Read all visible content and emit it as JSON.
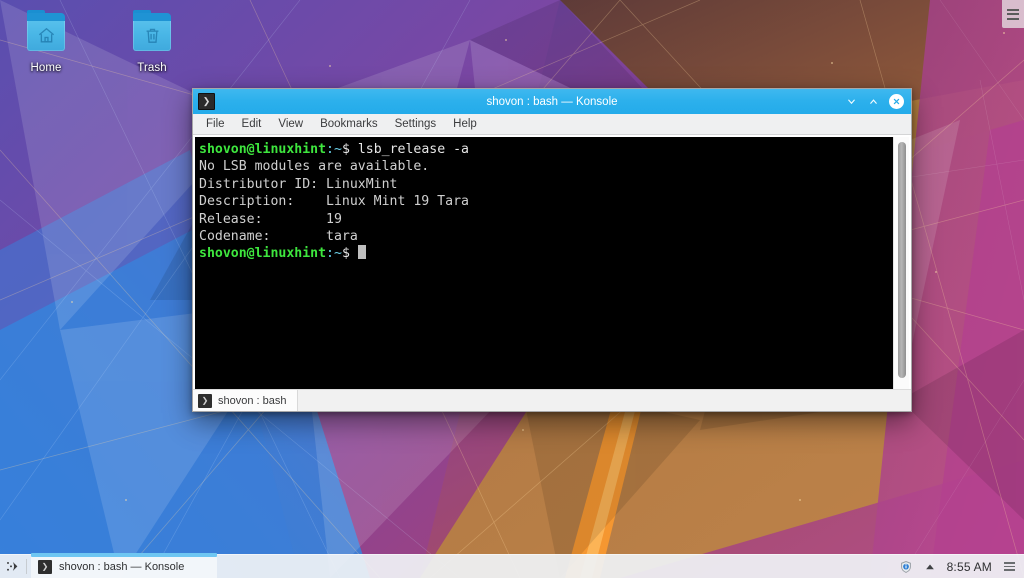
{
  "desktop": {
    "icons": [
      {
        "label": "Home",
        "icon": "home-folder-icon"
      },
      {
        "label": "Trash",
        "icon": "trash-folder-icon"
      }
    ],
    "toolbox_icon": "panel-toolbox-icon"
  },
  "window": {
    "title": "shovon : bash — Konsole",
    "app_icon": "konsole-icon",
    "icon_glyph": "❯",
    "buttons": {
      "minimize": "minimize-icon",
      "maximize": "maximize-icon",
      "close": "close-icon"
    },
    "menubar": [
      {
        "label": "File"
      },
      {
        "label": "Edit"
      },
      {
        "label": "View"
      },
      {
        "label": "Bookmarks"
      },
      {
        "label": "Settings"
      },
      {
        "label": "Help"
      }
    ],
    "tab": {
      "label": "shovon : bash",
      "icon": "terminal-tab-icon",
      "icon_glyph": "❯"
    }
  },
  "terminal": {
    "prompt_user": "shovon@linuxhint",
    "prompt_path": ":~",
    "prompt_sym": "$ ",
    "command": "lsb_release -a",
    "output": [
      "No LSB modules are available.",
      "Distributor ID: LinuxMint",
      "Description:\tLinux Mint 19 Tara",
      "Release:\t19",
      "Codename:\ttara"
    ],
    "lines": [
      "No LSB modules are available.",
      "Distributor ID: LinuxMint",
      "Description:    Linux Mint 19 Tara",
      "Release:        19",
      "Codename:       tara"
    ],
    "colors": {
      "background": "#000000",
      "user": "#3ee63e",
      "path": "#6bd0e8",
      "text": "#d0d0d0",
      "cursor": "#bfbfbf"
    }
  },
  "taskbar": {
    "launcher_icon": "application-launcher-icon",
    "task": {
      "label": "shovon : bash — Konsole",
      "icon": "konsole-taskbar-icon",
      "icon_glyph": "❯",
      "active": true
    },
    "tray": [
      {
        "name": "update-manager-shield-icon"
      },
      {
        "name": "show-hidden-tray-arrow-icon"
      }
    ],
    "clock": "8:55 AM",
    "menu_icon": "panel-menu-icon"
  },
  "theme": {
    "titlebar_active": "#2cb0ec",
    "accent": "#6ec6f2",
    "panel_bg": "#eff2f5",
    "window_bg": "#eff0f1"
  }
}
